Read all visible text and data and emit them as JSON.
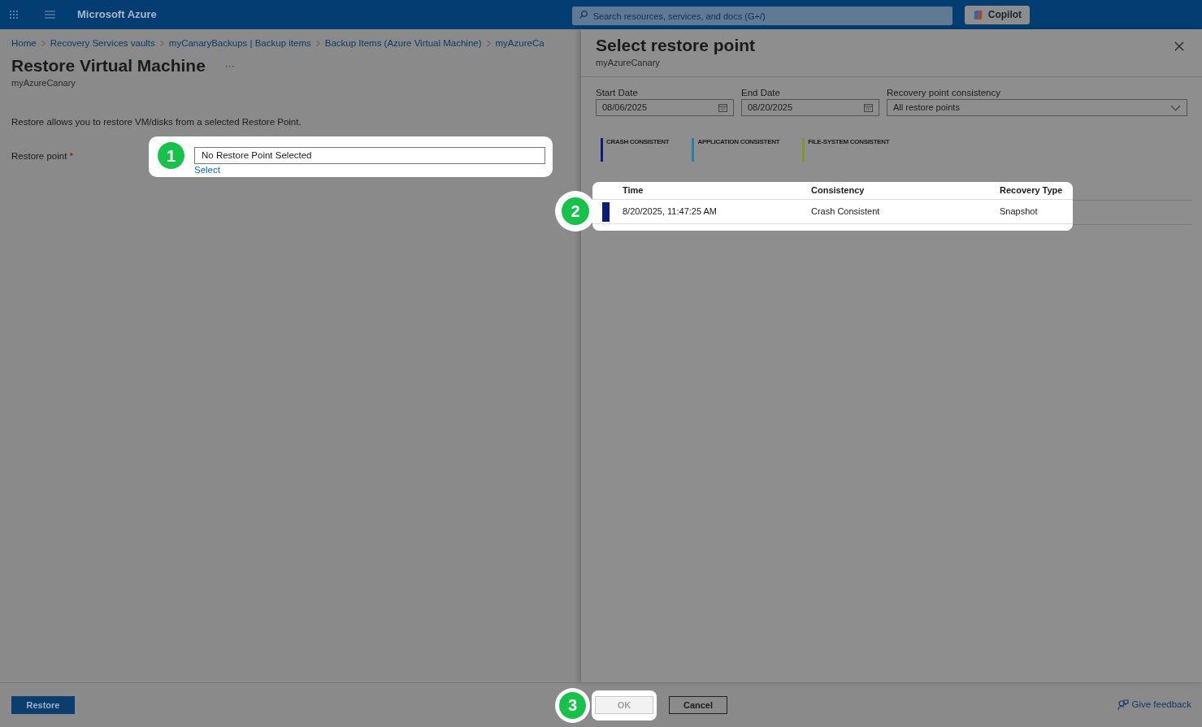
{
  "top_bar": {
    "brand": "Microsoft Azure",
    "search": {
      "placeholder": "Search resources, services, and docs (G+/)"
    },
    "copilot_button": "Copilot"
  },
  "breadcrumb": [
    "Home",
    "Recovery Services vaults",
    "myCanaryBackups | Backup items",
    "Backup Items (Azure Virtual Machine)",
    "myAzureCa"
  ],
  "page": {
    "title": "Restore Virtual Machine",
    "more": "···",
    "subtitle": "myAzureCanary",
    "description": "Restore allows you to restore VM/disks from a selected Restore Point.",
    "restore_point": {
      "label": "Restore point",
      "required_mark": "*",
      "value": "No Restore Point Selected",
      "link": "Select",
      "callout": "1"
    }
  },
  "panel": {
    "title": "Select restore point",
    "subtitle": "myAzureCanary",
    "filters": [
      {
        "label": "Start Date",
        "kind": "date",
        "value": "08/06/2025"
      },
      {
        "label": "End Date",
        "kind": "date",
        "value": "08/20/2025"
      },
      {
        "label": "Recovery point consistency",
        "kind": "dropdown",
        "value": "All restore points"
      }
    ],
    "legend": [
      {
        "label": "CRASH CONSISTENT",
        "color": "#0a1e78"
      },
      {
        "label": "APPLICATION CONSISTENT",
        "color": "#2a7ea6"
      },
      {
        "label": "FILE-SYSTEM CONSISTENT",
        "color": "#7a9a2a"
      }
    ],
    "table": {
      "columns": [
        "Time",
        "Consistency",
        "Recovery Type"
      ],
      "callout": "2",
      "rows": [
        {
          "color": "#0a1e78",
          "cells": [
            "8/20/2025, 11:47:25 AM",
            "Crash Consistent",
            "Snapshot"
          ]
        }
      ]
    }
  },
  "footer": {
    "restore_button": "Restore",
    "ok_button": {
      "label": "OK",
      "disabled": true,
      "callout": "3"
    },
    "cancel_button": "Cancel",
    "feedback_link": "Give feedback"
  }
}
